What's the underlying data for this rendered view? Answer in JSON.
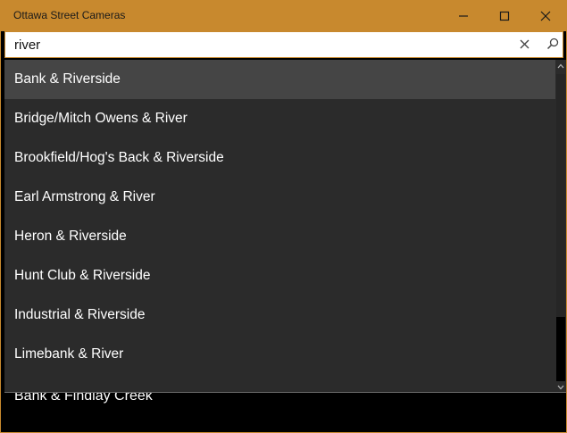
{
  "window": {
    "title": "Ottawa Street Cameras",
    "accent": "#c8892e"
  },
  "caption_buttons": {
    "minimize_icon": "minimize-icon",
    "maximize_icon": "maximize-icon",
    "close_icon": "close-icon"
  },
  "search": {
    "value": "river",
    "clear_icon": "close-icon",
    "submit_icon": "search-icon"
  },
  "suggestions": [
    {
      "label": "Bank & Riverside",
      "selected": true
    },
    {
      "label": "Bridge/Mitch Owens & River",
      "selected": false
    },
    {
      "label": "Brookfield/Hog's Back & Riverside",
      "selected": false
    },
    {
      "label": "Earl Armstrong & River",
      "selected": false
    },
    {
      "label": "Heron & Riverside",
      "selected": false
    },
    {
      "label": "Hunt Club & Riverside",
      "selected": false
    },
    {
      "label": "Industrial & Riverside",
      "selected": false
    },
    {
      "label": "Limebank & River",
      "selected": false
    }
  ],
  "background_list": {
    "items": [
      "Bank & Findlay Creek"
    ]
  }
}
